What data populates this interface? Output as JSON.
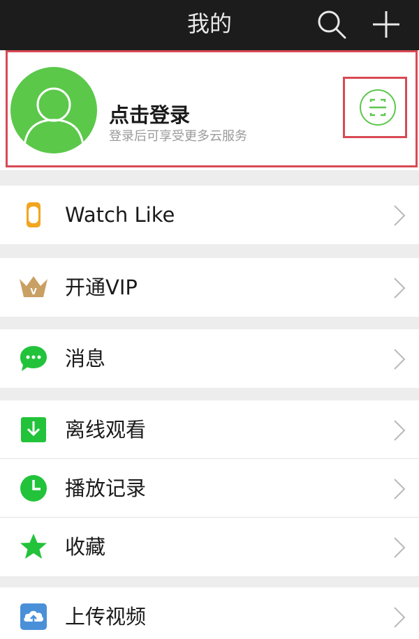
{
  "header": {
    "title": "我的",
    "search_icon": "search-icon",
    "add_icon": "plus-icon"
  },
  "profile": {
    "title": "点击登录",
    "subtitle": "登录后可享受更多云服务",
    "avatar_icon": "user-avatar-icon",
    "scan_icon": "scan-qr-icon"
  },
  "menu": {
    "watch": {
      "label": "Watch Like",
      "icon": "watch-icon"
    },
    "vip": {
      "label": "开通VIP",
      "icon": "crown-icon"
    },
    "messages": {
      "label": "消息",
      "icon": "chat-bubble-icon"
    },
    "offline": {
      "label": "离线观看",
      "icon": "download-icon"
    },
    "history": {
      "label": "播放记录",
      "icon": "clock-icon"
    },
    "favorites": {
      "label": "收藏",
      "icon": "star-icon"
    },
    "upload": {
      "label": "上传视频",
      "icon": "cloud-upload-icon"
    }
  },
  "colors": {
    "topbar": "#1c1c1c",
    "accent_green": "#22c33a",
    "avatar_green": "#5bc84a",
    "highlight_red": "#d84a54",
    "vip_gold": "#c9a063",
    "watch_orange": "#f2a51f",
    "upload_blue": "#4a90d9"
  }
}
